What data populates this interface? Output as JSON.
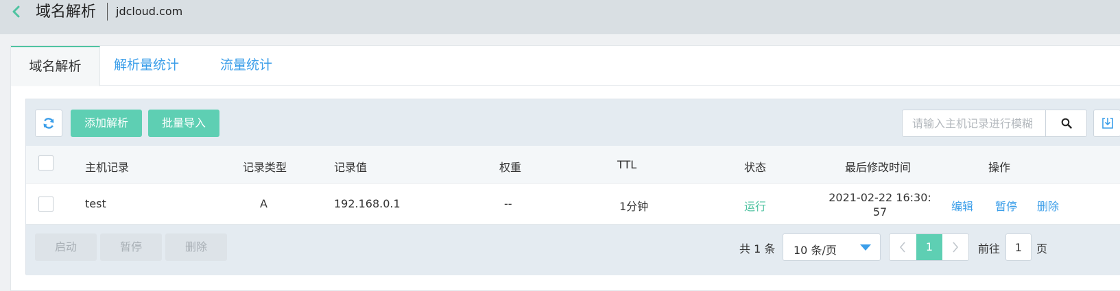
{
  "header": {
    "title": "域名解析",
    "domain": "jdcloud.com"
  },
  "tabs": [
    {
      "label": "域名解析",
      "active": true
    },
    {
      "label": "解析量统计",
      "active": false
    },
    {
      "label": "流量统计",
      "active": false
    }
  ],
  "toolbar": {
    "add_label": "添加解析",
    "import_label": "批量导入",
    "search_placeholder": "请输入主机记录进行模糊",
    "search_value": ""
  },
  "table": {
    "columns": [
      "主机记录",
      "记录类型",
      "记录值",
      "权重",
      "TTL",
      "状态",
      "最后修改时间",
      "操作"
    ],
    "rows": [
      {
        "host": "test",
        "type": "A",
        "value": "192.168.0.1",
        "weight": "--",
        "ttl": "1分钟",
        "status": "运行",
        "modified": "2021-02-22 16:30:57",
        "actions": [
          "编辑",
          "暂停",
          "删除"
        ]
      }
    ]
  },
  "footer": {
    "batch_buttons": [
      "启动",
      "暂停",
      "删除"
    ],
    "total_text": "共 1 条",
    "page_size": "10 条/页",
    "current_page": "1",
    "goto_label": "前往",
    "goto_value": "1",
    "page_unit": "页"
  },
  "colors": {
    "accent_green": "#5ecfb3",
    "link_blue": "#3b9ee9",
    "status_green": "#4fc3a1",
    "header_bg": "#d9dfe3",
    "toolbar_bg": "#e4ebf1"
  },
  "icons": {
    "back": "chevron-left-icon",
    "refresh": "refresh-icon",
    "search": "search-icon",
    "download": "download-icon",
    "page_size_dropdown": "caret-down-icon",
    "prev": "chevron-left-icon",
    "next": "chevron-right-icon"
  }
}
